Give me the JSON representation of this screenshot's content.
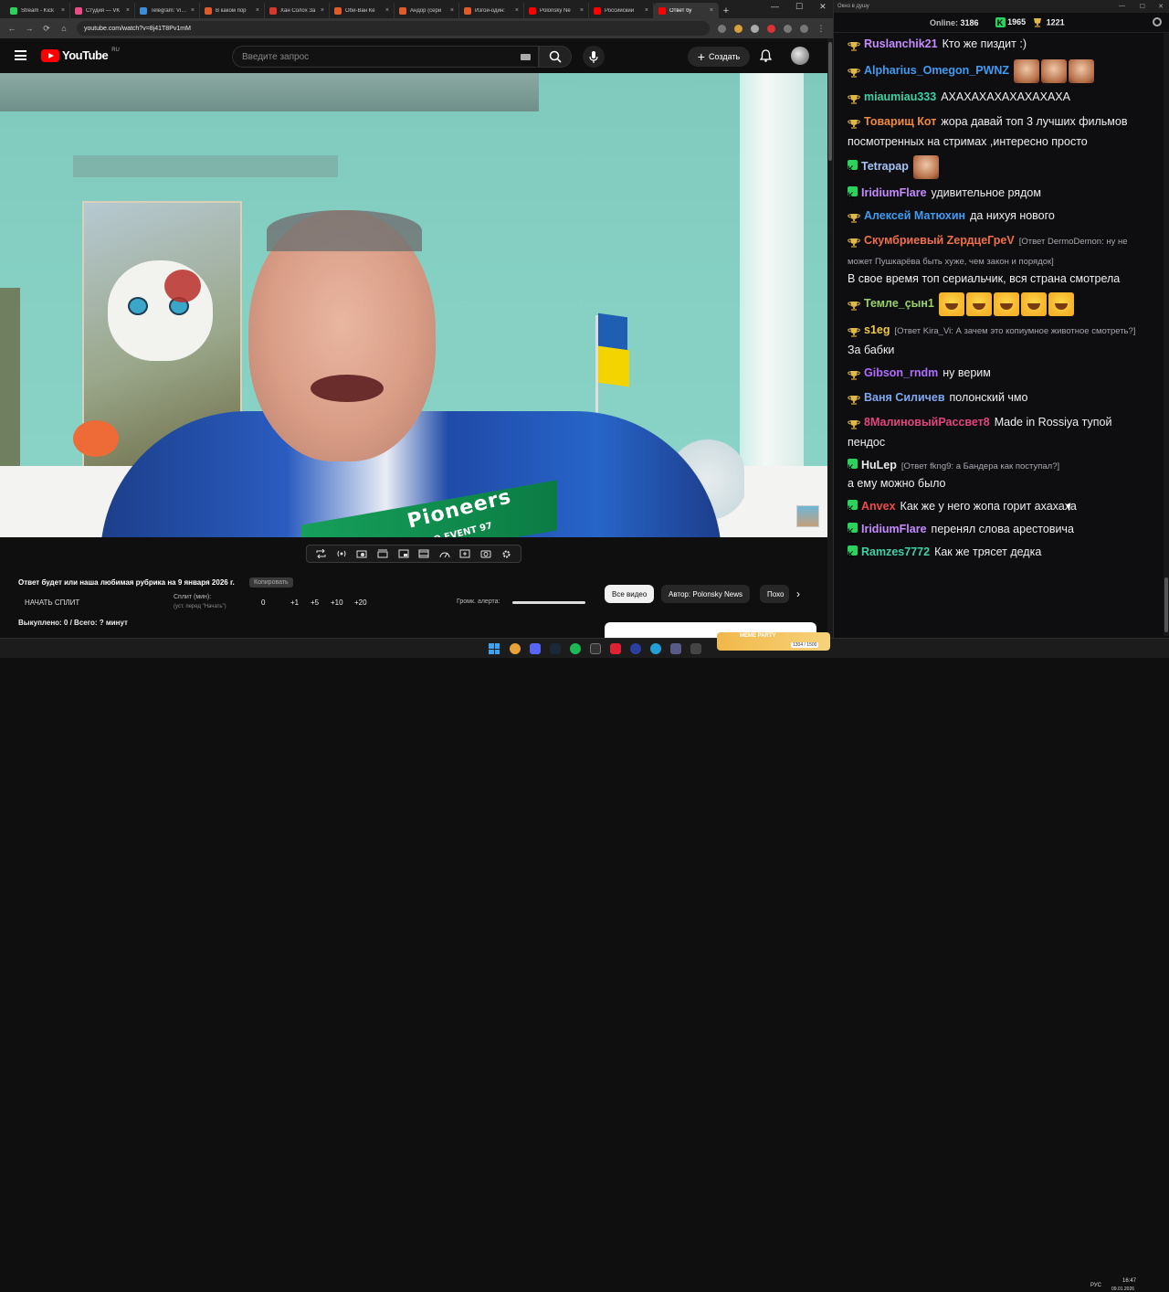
{
  "browser": {
    "tabs": [
      {
        "title": "Stream - Kick",
        "color": "#2bd35d"
      },
      {
        "title": "Студия — VK",
        "color": "#e94b85"
      },
      {
        "title": "Telegram: View",
        "color": "#3c8edb"
      },
      {
        "title": "В каком пор",
        "color": "#e05a2a"
      },
      {
        "title": "Хан Солох За",
        "color": "#d9362c"
      },
      {
        "title": "Оби-Ван Ке",
        "color": "#e05a2a"
      },
      {
        "title": "Андор (сери",
        "color": "#e05a2a"
      },
      {
        "title": "Изгой-один:",
        "color": "#e05a2a"
      },
      {
        "title": "Polonsky Ne",
        "color": "#ff0000"
      },
      {
        "title": "Российский",
        "color": "#ff0000"
      },
      {
        "title": "Ответ бу",
        "color": "#ff0000",
        "active": true
      }
    ],
    "new_tab": "+",
    "url": "youtube.com/watch?v=8j41T8Pv1mM"
  },
  "youtube": {
    "logo_text": "YouTube",
    "region": "RU",
    "search_placeholder": "Введите запрос",
    "create_label": "Создать"
  },
  "video": {
    "title": "Ответ будет или наша любимая рубрика на 9 января 2026 г.",
    "title_badge": "Копировать"
  },
  "split": {
    "start_label": "НАЧАТЬ СПЛИТ",
    "label": "Сплит (мин):",
    "sub": "(уст. перед \"Начать\")",
    "value": "0",
    "buttons": [
      "+1",
      "+5",
      "+10",
      "+20"
    ],
    "volume_label": "Громк. алерта:",
    "volume": 1.0,
    "bought": "Выкуплено: 0 / Всего: ? минут"
  },
  "chips": [
    "Все видео",
    "Автор: Polonsky News",
    "Похо"
  ],
  "chat": {
    "window_title": "Окно в душу",
    "online_label": "Online:",
    "online_count": "3186",
    "kick_count": "1965",
    "trophy_count": "1221",
    "messages": [
      {
        "badge": "cup",
        "user": "Ruslanchik21",
        "color": "#c68bff",
        "text": "Кто же пиздит :)"
      },
      {
        "badge": "cup",
        "user": "Alpharius_Omegon_PWNZ",
        "color": "#3f9cf2",
        "text": "",
        "emotes": [
          "face",
          "face",
          "face"
        ]
      },
      {
        "badge": "cup",
        "user": "miaumiau333",
        "color": "#3fd1a6",
        "text": "АХАХАХАХАХАХАХАХА"
      },
      {
        "badge": "cup",
        "user": "Товарищ Кот",
        "color": "#f08a3e",
        "text": "жора давай топ 3 лучших фильмов посмотренных на стримах ,интересно просто"
      },
      {
        "badge": "kick",
        "user": "Tetrapap",
        "color": "#a7c2f5",
        "text": "",
        "emotes": [
          "face"
        ]
      },
      {
        "badge": "kick",
        "user": "IridiumFlare",
        "color": "#c68bff",
        "text": "удивительное рядом"
      },
      {
        "badge": "cup",
        "user": "Алексей Матюхин",
        "color": "#3f9cf2",
        "text": "да нихуя нового"
      },
      {
        "badge": "cup",
        "user": "Скумбриевый ZердцеГреV",
        "color": "#f0704a",
        "reply": "[Ответ DermoDemon: ну не может Пушкарёва быть хуже, чем закон и порядок]",
        "text": "В свое время топ сериальчик, вся страна смотрела"
      },
      {
        "badge": "cup",
        "user": "Темле_çын1",
        "color": "#9bd36a",
        "text": "",
        "emotes": [
          "laugh",
          "laugh",
          "laugh",
          "laugh",
          "laugh"
        ]
      },
      {
        "badge": "cup",
        "user": "s1eg",
        "color": "#f2c84b",
        "reply": "[Ответ Kira_Vi: А зачем это копиумное животное смотреть?]",
        "text": "За бабки"
      },
      {
        "badge": "cup",
        "user": "Gibson_rndm",
        "color": "#b06bff",
        "text": "ну верим"
      },
      {
        "badge": "cup",
        "user": "Ваня Силичев",
        "color": "#7fa8f0",
        "text": "полонский чмо"
      },
      {
        "badge": "cup",
        "user": "8МалиновыйРассвет8",
        "color": "#e0467a",
        "text": "Made in Rossiya тупой пендос"
      },
      {
        "badge": "kick",
        "user": "HuLep",
        "color": "#e9e9e9",
        "reply": "[Ответ fkng9: а Бандера как поступал?]",
        "text": "а ему можно было"
      },
      {
        "badge": "kick",
        "user": "Anvex",
        "color": "#ef4b4b",
        "text": "Как же у него жопа горит ахахаха"
      },
      {
        "badge": "kick",
        "user": "IridiumFlare",
        "color": "#c68bff",
        "text": "перенял слова арестовича"
      },
      {
        "badge": "kick",
        "user": "Ramzes7772",
        "color": "#3fd1a6",
        "text": "Как же трясет дедка"
      }
    ]
  },
  "taskbar": {
    "meme_label": "MEME PARTY",
    "meme_count": "1304 / 1500",
    "lang": "РУС",
    "time": "16:47",
    "date": "09.01.2026"
  }
}
